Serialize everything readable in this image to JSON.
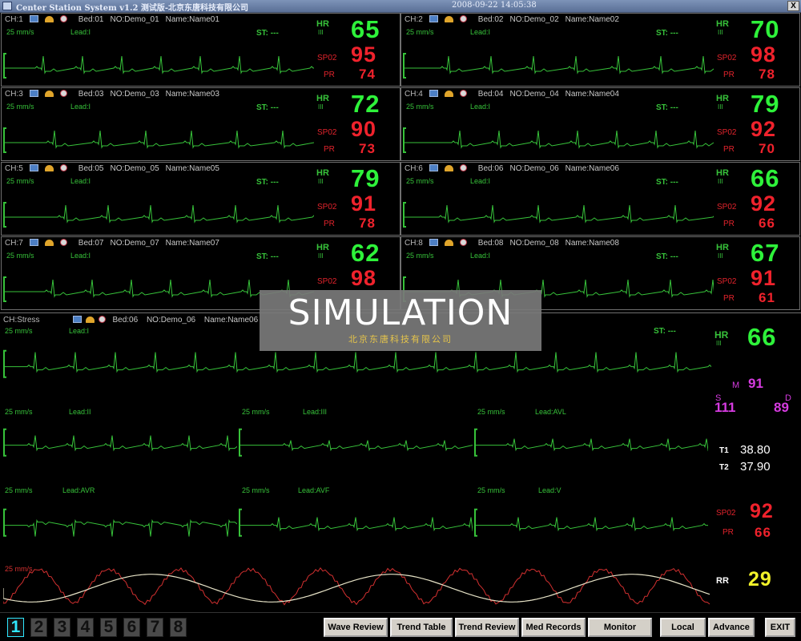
{
  "window": {
    "title": "Center Station System v1.2 测试版-北京东唐科技有限公司",
    "datetime": "2008-09-22 14:05:38",
    "close_glyph": "X"
  },
  "channels": [
    {
      "ch": "CH:1",
      "bed": "Bed:01",
      "no": "NO:Demo_01",
      "name": "Name:Name01",
      "speed": "25 mm/s",
      "lead": "Lead:I",
      "st": "ST: ---",
      "hr_label": "HR",
      "hr_lead": "III",
      "hr": "65",
      "spo2_label": "SP02",
      "spo2": "95",
      "pr_label": "PR",
      "pr": "74"
    },
    {
      "ch": "CH:2",
      "bed": "Bed:02",
      "no": "NO:Demo_02",
      "name": "Name:Name02",
      "speed": "25 mm/s",
      "lead": "Lead:I",
      "st": "ST: ---",
      "hr_label": "HR",
      "hr_lead": "III",
      "hr": "70",
      "spo2_label": "SP02",
      "spo2": "98",
      "pr_label": "PR",
      "pr": "78"
    },
    {
      "ch": "CH:3",
      "bed": "Bed:03",
      "no": "NO:Demo_03",
      "name": "Name:Name03",
      "speed": "25 mm/s",
      "lead": "Lead:I",
      "st": "ST: ---",
      "hr_label": "HR",
      "hr_lead": "III",
      "hr": "72",
      "spo2_label": "SP02",
      "spo2": "90",
      "pr_label": "PR",
      "pr": "73"
    },
    {
      "ch": "CH:4",
      "bed": "Bed:04",
      "no": "NO:Demo_04",
      "name": "Name:Name04",
      "speed": "25 mm/s",
      "lead": "Lead:I",
      "st": "ST: ---",
      "hr_label": "HR",
      "hr_lead": "III",
      "hr": "79",
      "spo2_label": "SP02",
      "spo2": "92",
      "pr_label": "PR",
      "pr": "70"
    },
    {
      "ch": "CH:5",
      "bed": "Bed:05",
      "no": "NO:Demo_05",
      "name": "Name:Name05",
      "speed": "25 mm/s",
      "lead": "Lead:I",
      "st": "ST: ---",
      "hr_label": "HR",
      "hr_lead": "III",
      "hr": "79",
      "spo2_label": "SP02",
      "spo2": "91",
      "pr_label": "PR",
      "pr": "78"
    },
    {
      "ch": "CH:6",
      "bed": "Bed:06",
      "no": "NO:Demo_06",
      "name": "Name:Name06",
      "speed": "25 mm/s",
      "lead": "Lead:I",
      "st": "ST: ---",
      "hr_label": "HR",
      "hr_lead": "III",
      "hr": "66",
      "spo2_label": "SP02",
      "spo2": "92",
      "pr_label": "PR",
      "pr": "66"
    },
    {
      "ch": "CH:7",
      "bed": "Bed:07",
      "no": "NO:Demo_07",
      "name": "Name:Name07",
      "speed": "25 mm/s",
      "lead": "Lead:I",
      "st": "ST: ---",
      "hr_label": "HR",
      "hr_lead": "III",
      "hr": "62",
      "spo2_label": "SP02",
      "spo2": "98",
      "pr_label": "",
      "pr": ""
    },
    {
      "ch": "CH:8",
      "bed": "Bed:08",
      "no": "NO:Demo_08",
      "name": "Name:Name08",
      "speed": "25 mm/s",
      "lead": "Lead:I",
      "st": "ST: ---",
      "hr_label": "HR",
      "hr_lead": "III",
      "hr": "67",
      "spo2_label": "SP02",
      "spo2": "91",
      "pr_label": "PR",
      "pr": "61"
    }
  ],
  "stress": {
    "ch": "CH:Stress",
    "bed": "Bed:06",
    "no": "NO:Demo_06",
    "name": "Name:Name06",
    "main": {
      "speed": "25 mm/s",
      "lead": "Lead:I",
      "st": "ST: ---"
    },
    "hr_label": "HR",
    "hr_lead": "III",
    "hr": "66",
    "leads_row1": [
      {
        "speed": "25 mm/s",
        "lead": "Lead:II"
      },
      {
        "speed": "25 mm/s",
        "lead": "Lead:III"
      },
      {
        "speed": "25 mm/s",
        "lead": "Lead:AVL"
      }
    ],
    "leads_row2": [
      {
        "speed": "25 mm/s",
        "lead": "Lead:AVR"
      },
      {
        "speed": "25 mm/s",
        "lead": "Lead:AVF"
      },
      {
        "speed": "25 mm/s",
        "lead": "Lead:V"
      }
    ],
    "resp_speed": "25 mm/s",
    "nibp": {
      "m_label": "M",
      "m": "91",
      "s_label": "S",
      "s": "111",
      "d_label": "D",
      "d": "89"
    },
    "temp": {
      "t1_label": "T1",
      "t1": "38.80",
      "t2_label": "T2",
      "t2": "37.90"
    },
    "spo2_label": "SP02",
    "spo2": "92",
    "pr_label": "PR",
    "pr": "66",
    "rr_label": "RR",
    "rr": "29"
  },
  "overlay": {
    "title": "SIMULATION",
    "subtitle": "北京东唐科技有限公司"
  },
  "pages": [
    "1",
    "2",
    "3",
    "4",
    "5",
    "6",
    "7",
    "8"
  ],
  "active_page": "1",
  "buttons": {
    "wave_review": "Wave Review",
    "trend_table": "Trend Table",
    "trend_review": "Trend Review",
    "med_records": "Med Records",
    "monitor": "Monitor",
    "local": "Local",
    "advance": "Advance",
    "exit": "EXIT"
  },
  "colors": {
    "ecg": "#37c23a",
    "hr": "#2ef23a",
    "spo2": "#f0222c",
    "nibp": "#d63be0",
    "temp": "#ffffff",
    "rr": "#f2f22a",
    "resp_wave": "#d43030",
    "pleth_wave": "#e6e2c6"
  }
}
